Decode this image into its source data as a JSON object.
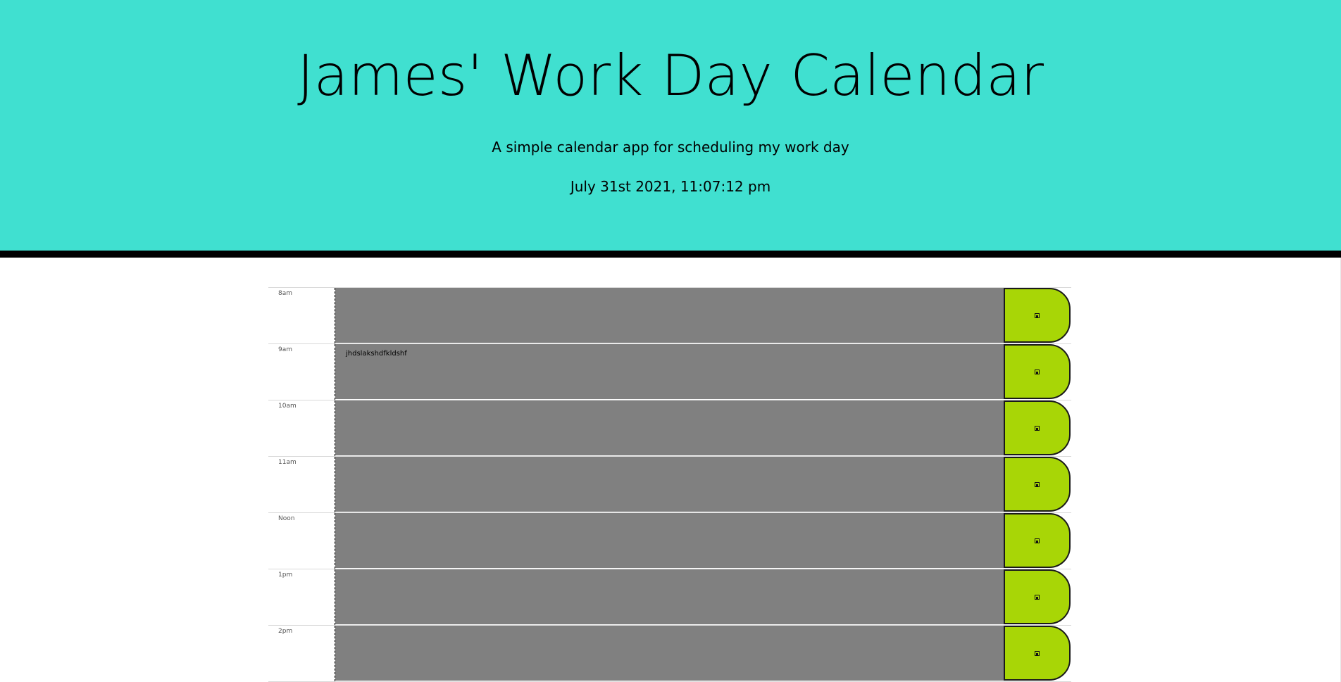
{
  "header": {
    "title": "James' Work Day Calendar",
    "lead": "A simple calendar app for scheduling my work day",
    "current_day": "July 31st 2021, 11:07:12 pm"
  },
  "colors": {
    "header_bg": "#40e0d0",
    "past_slot": "#808080",
    "save_button": "#a8d606"
  },
  "timeblocks": [
    {
      "hour": "8am",
      "text": ""
    },
    {
      "hour": "9am",
      "text": "jhdslakshdfkldshf"
    },
    {
      "hour": "10am",
      "text": ""
    },
    {
      "hour": "11am",
      "text": ""
    },
    {
      "hour": "Noon",
      "text": ""
    },
    {
      "hour": "1pm",
      "text": ""
    },
    {
      "hour": "2pm",
      "text": ""
    }
  ],
  "save_icon": "save-icon"
}
